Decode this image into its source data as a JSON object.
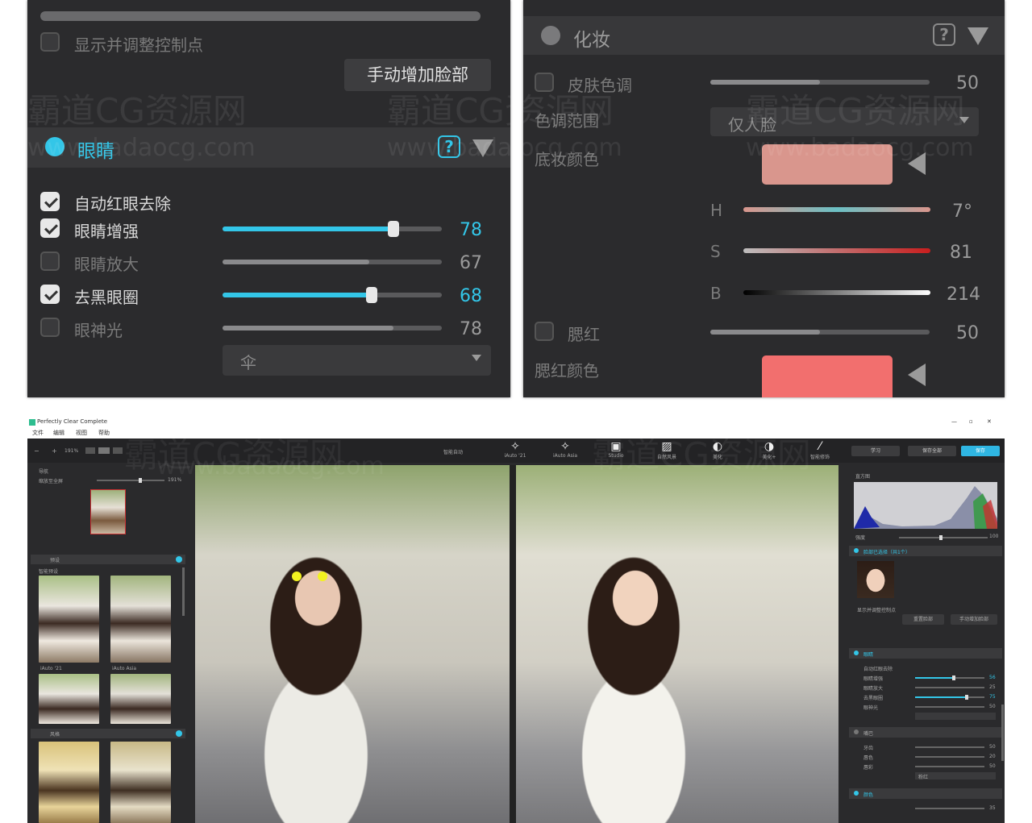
{
  "eye_panel": {
    "show_control_points_label": "显示并调整控制点",
    "add_face_button": "手动增加脸部",
    "section_title": "眼睛",
    "help_label": "?",
    "rows": [
      {
        "label": "自动红眼去除",
        "checked": true
      },
      {
        "label": "眼睛增强",
        "checked": true,
        "value": "78",
        "level": 0.78
      },
      {
        "label": "眼睛放大",
        "checked": false,
        "value": "67",
        "level": 0.67
      },
      {
        "label": "去黑眼圈",
        "checked": true,
        "value": "68",
        "level": 0.68
      },
      {
        "label": "眼神光",
        "checked": false,
        "value": "78",
        "level": 0.78
      }
    ],
    "catchlight_select": "伞"
  },
  "makeup_panel": {
    "section_title": "化妆",
    "help_label": "?",
    "skin_tone_label": "皮肤色调",
    "skin_tone_value": "50",
    "skin_tone_level": 0.5,
    "tone_range_label": "色调范围",
    "tone_range_value": "仅人脸",
    "foundation_color_label": "底妆颜色",
    "foundation_color": "#d9968d",
    "h_label": "H",
    "h_value": "7°",
    "s_label": "S",
    "s_value": "81",
    "b_label": "B",
    "b_value": "214",
    "blush_label": "腮红",
    "blush_value": "50",
    "blush_level": 0.5,
    "blush_color_label": "腮红颜色",
    "blush_color": "#f26f6e"
  },
  "watermark": {
    "line1": "霸道CG资源网",
    "line2": "www.badaocg.com"
  },
  "app": {
    "title": "Perfectly Clear Complete",
    "window_controls": [
      "—",
      "▫",
      "✕"
    ],
    "menu": [
      "文件",
      "编辑",
      "视图",
      "帮助"
    ],
    "zoom": "191%",
    "preset_select": "智能自动",
    "tools": [
      {
        "icon": "✧",
        "label": "iAuto '21"
      },
      {
        "icon": "✧",
        "label": "iAuto Asia"
      },
      {
        "icon": "▣",
        "label": "Studio"
      },
      {
        "icon": "▨",
        "label": "自然风景"
      },
      {
        "icon": "◐",
        "label": "美化"
      },
      {
        "icon": "◑",
        "label": "美化+"
      },
      {
        "icon": "⁄",
        "label": "智能修饰"
      }
    ],
    "top_buttons": {
      "learn": "学习",
      "save_all": "保存全部",
      "save": "保存"
    },
    "left": {
      "navigator_label": "导航",
      "zoom_label": "缩放至全屏",
      "zoom_value": "191%",
      "presets_label": "预设",
      "smart_presets_label": "智能预设",
      "thumbs": [
        "iAuto '21",
        "iAuto Asia",
        "",
        ""
      ],
      "styles_label": "风格"
    },
    "right": {
      "histogram_label": "直方图",
      "strength_label": "强度",
      "strength_value": "100",
      "face_section": "脸部已选择（共1个）",
      "show_points": "显示并调整控制点",
      "reset_button": "重置脸部",
      "add_face_button": "手动增加脸部",
      "eyes_section": "眼睛",
      "eye_rows": [
        {
          "label": "自动红眼去除",
          "value": ""
        },
        {
          "label": "眼睛增强",
          "value": "56"
        },
        {
          "label": "眼睛放大",
          "value": "25"
        },
        {
          "label": "去黑眼圈",
          "value": "75"
        },
        {
          "label": "眼神光",
          "value": "50"
        }
      ],
      "mouth_section": "嘴巴",
      "mouth_rows": [
        {
          "label": "牙齿",
          "value": "50"
        },
        {
          "label": "唇色",
          "value": "20"
        },
        {
          "label": "唇彩",
          "value": "50"
        }
      ],
      "mouth_select": "粉红",
      "makeup_section": "颜色",
      "makeup_value": "35"
    }
  }
}
